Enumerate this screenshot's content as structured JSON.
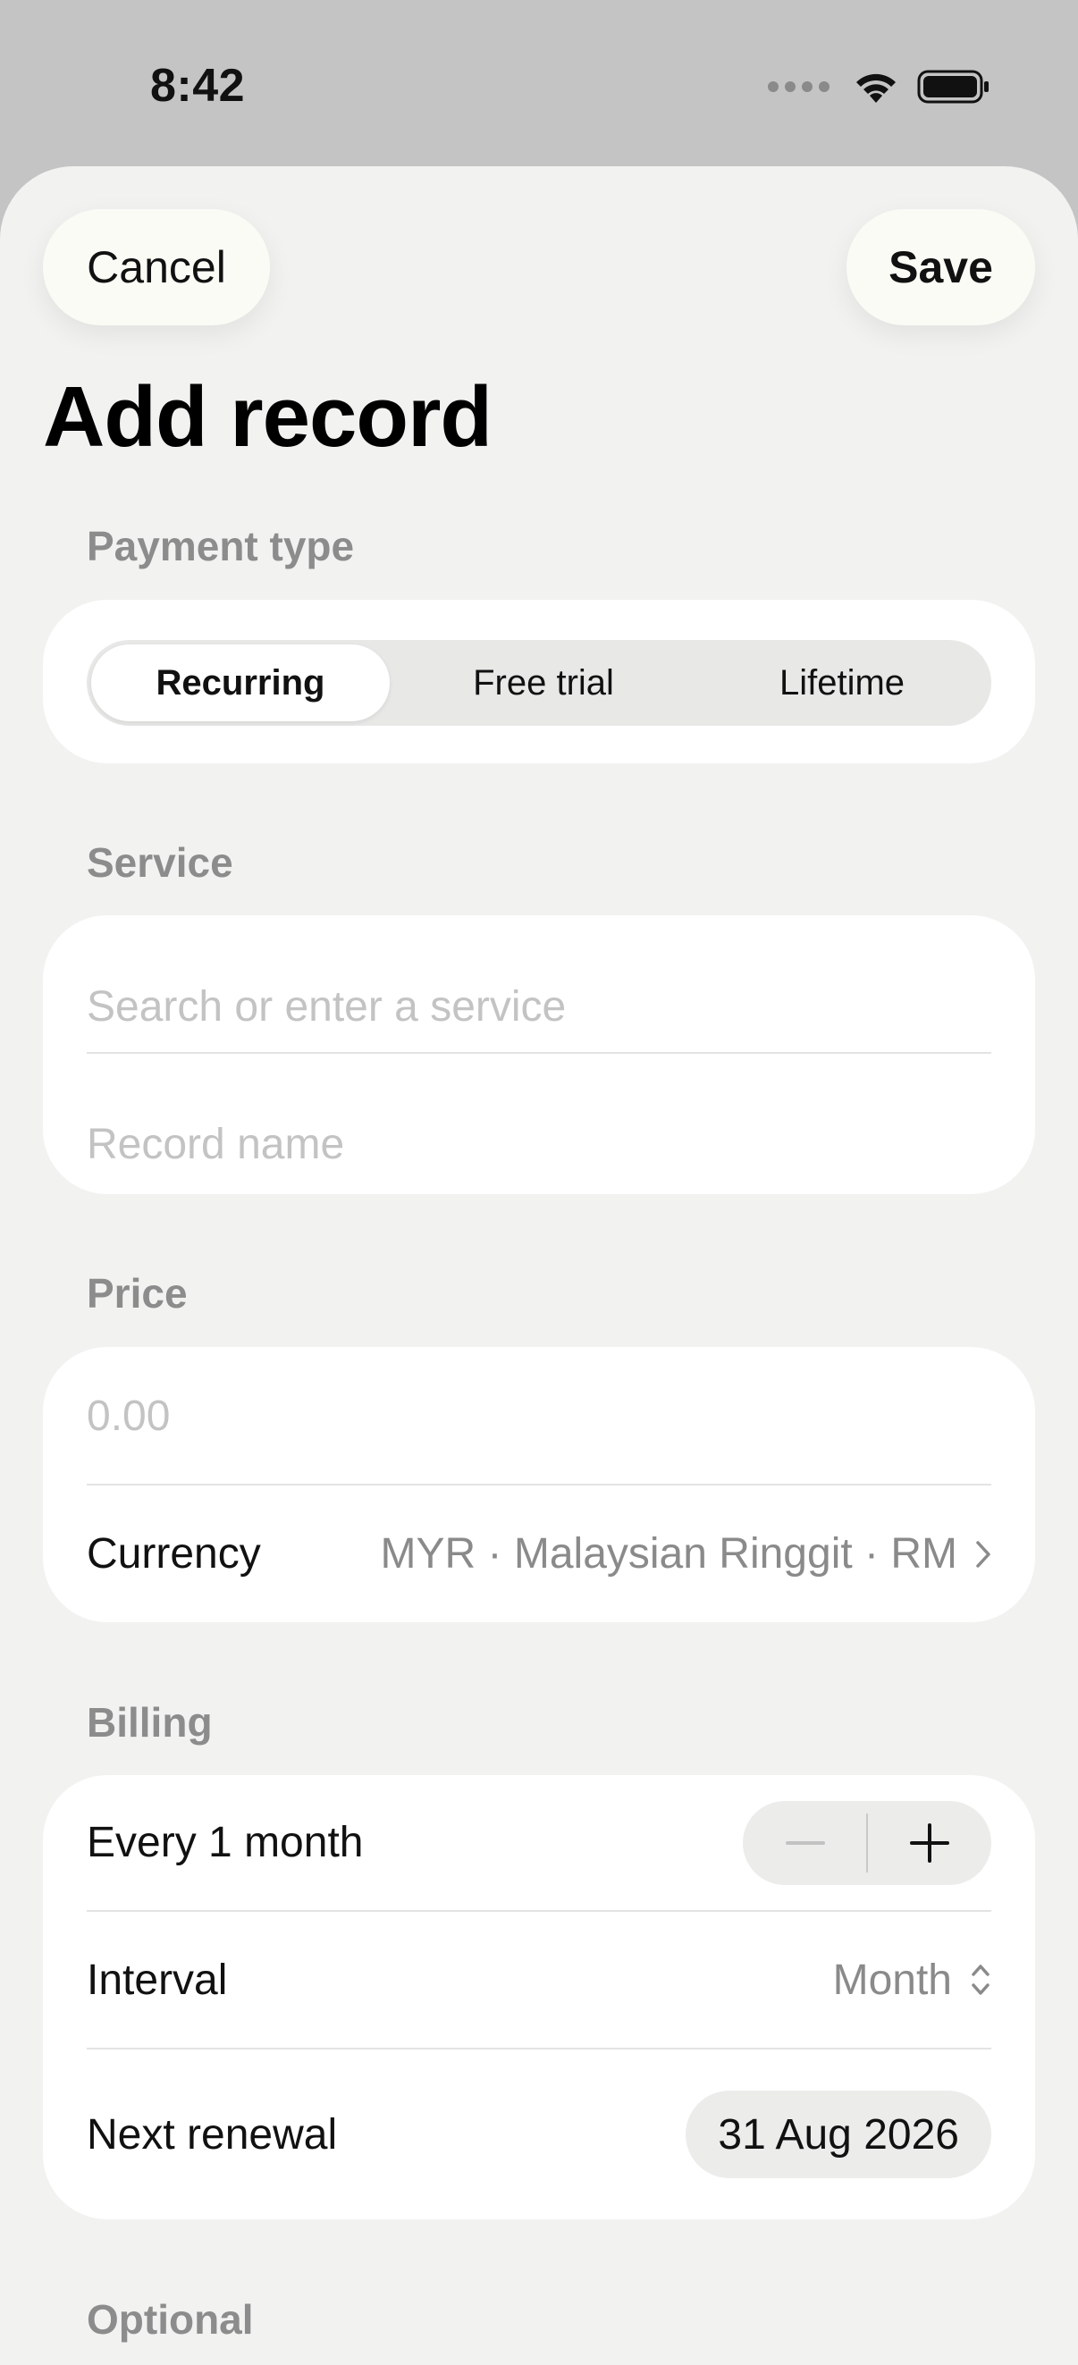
{
  "status_bar": {
    "time": "8:42"
  },
  "header": {
    "cancel_label": "Cancel",
    "save_label": "Save",
    "title": "Add record"
  },
  "payment_type": {
    "label": "Payment type",
    "options": [
      "Recurring",
      "Free trial",
      "Lifetime"
    ],
    "selected": "Recurring"
  },
  "service": {
    "label": "Service",
    "search_placeholder": "Search or enter a service",
    "name_placeholder": "Record name"
  },
  "price": {
    "label": "Price",
    "amount_placeholder": "0.00",
    "currency_label": "Currency",
    "currency_value": "MYR · Malaysian Ringgit · RM"
  },
  "billing": {
    "label": "Billing",
    "every_text": "Every 1 month",
    "interval_label": "Interval",
    "interval_value": "Month",
    "next_renewal_label": "Next renewal",
    "next_renewal_value": "31 Aug 2026"
  },
  "optional": {
    "label": "Optional"
  }
}
